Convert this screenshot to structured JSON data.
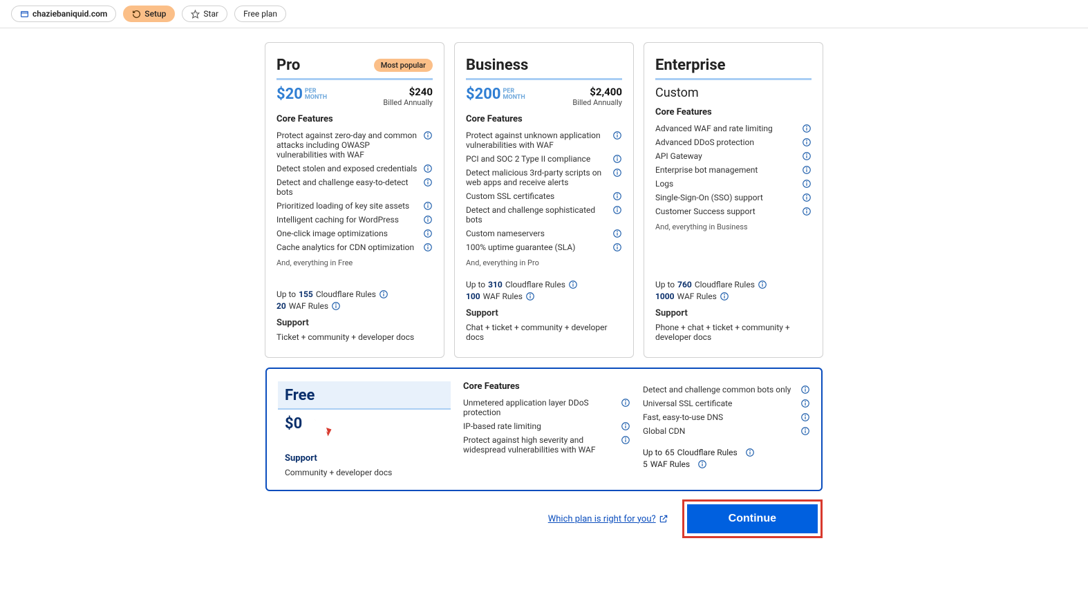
{
  "header": {
    "domain": "chaziebaniquid.com",
    "setup": "Setup",
    "star": "Star",
    "plan": "Free plan"
  },
  "plans": {
    "pro": {
      "name": "Pro",
      "badge": "Most popular",
      "price": "$20",
      "per": "PER\nMONTH",
      "total": "$240",
      "billed": "Billed Annually",
      "core_title": "Core Features",
      "features": [
        "Protect against zero-day and common attacks including OWASP vulnerabilities with WAF",
        "Detect stolen and exposed credentials",
        "Detect and challenge easy-to-detect bots",
        "Prioritized loading of key site assets",
        "Intelligent caching for WordPress",
        "One-click image optimizations",
        "Cache analytics for CDN optimization"
      ],
      "everything": "And, everything in Free",
      "rules_pre": "Up to ",
      "rules_n": "155",
      "rules_post": " Cloudflare Rules",
      "waf_n": "20",
      "waf_post": " WAF Rules",
      "support_title": "Support",
      "support": "Ticket + community + developer docs"
    },
    "business": {
      "name": "Business",
      "price": "$200",
      "per": "PER\nMONTH",
      "total": "$2,400",
      "billed": "Billed Annually",
      "core_title": "Core Features",
      "features": [
        "Protect against unknown application vulnerabilities with WAF",
        "PCI and SOC 2 Type II compliance",
        "Detect malicious 3rd-party scripts on web apps and receive alerts",
        "Custom SSL certificates",
        "Detect and challenge sophisticated bots",
        "Custom nameservers",
        "100% uptime guarantee (SLA)"
      ],
      "everything": "And, everything in Pro",
      "rules_pre": "Up to ",
      "rules_n": "310",
      "rules_post": " Cloudflare Rules",
      "waf_n": "100",
      "waf_post": " WAF Rules",
      "support_title": "Support",
      "support": "Chat + ticket + community + developer docs"
    },
    "enterprise": {
      "name": "Enterprise",
      "price": "Custom",
      "core_title": "Core Features",
      "features": [
        "Advanced WAF and rate limiting",
        "Advanced DDoS protection",
        "API Gateway",
        "Enterprise bot management",
        "Logs",
        "Single-Sign-On (SSO) support",
        "Customer Success support"
      ],
      "everything": "And, everything in Business",
      "rules_pre": "Up to ",
      "rules_n": "760",
      "rules_post": " Cloudflare Rules",
      "waf_n": "1000",
      "waf_post": " WAF Rules",
      "support_title": "Support",
      "support": "Phone + chat + ticket + community + developer docs"
    },
    "free": {
      "name": "Free",
      "price": "$0",
      "core_title": "Core Features",
      "features_a": [
        "Unmetered application layer DDoS protection",
        "IP-based rate limiting",
        "Protect against high severity and widespread vulnerabilities with WAF"
      ],
      "features_b": [
        "Detect and challenge common bots only",
        "Universal SSL certificate",
        "Fast, easy-to-use DNS",
        "Global CDN"
      ],
      "rules_pre": "Up to ",
      "rules_n": "65",
      "rules_post": " Cloudflare Rules",
      "waf_n": "5",
      "waf_post": " WAF Rules",
      "support_title": "Support",
      "support": "Community + developer docs"
    }
  },
  "actions": {
    "which": "Which plan is right for you?",
    "continue": "Continue"
  }
}
